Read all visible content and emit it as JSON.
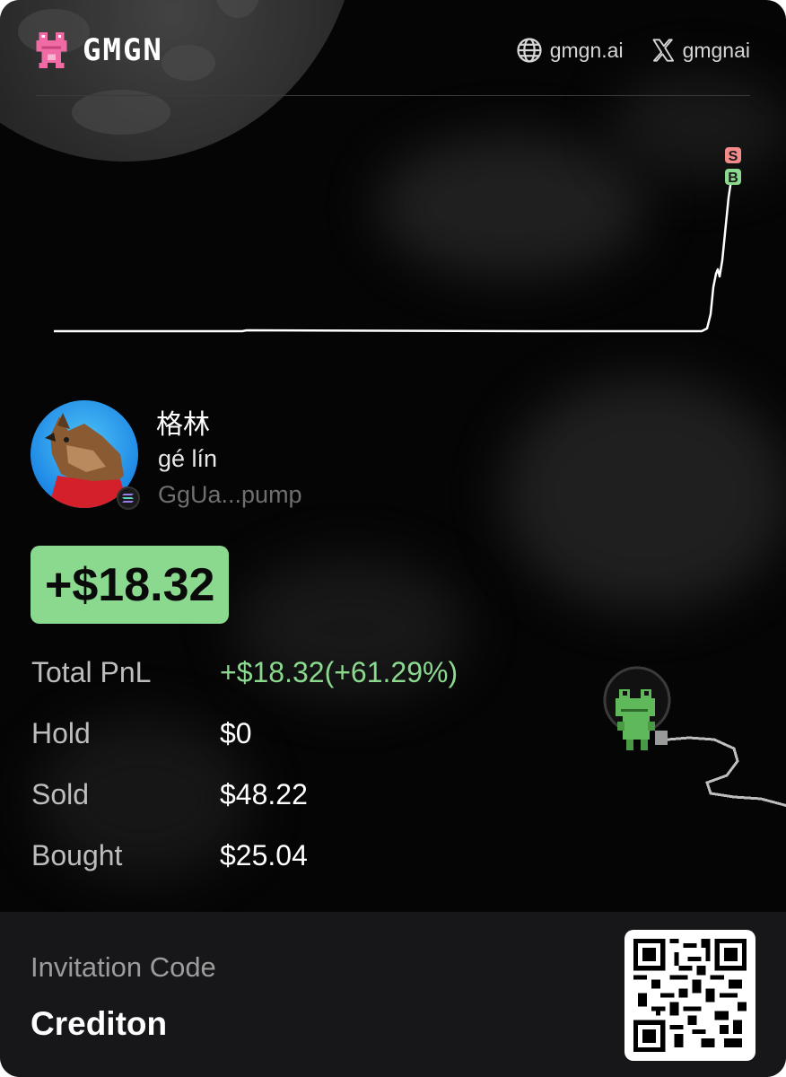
{
  "brand": {
    "name": "GMGN",
    "logo_icon": "pink-frog-logo-icon"
  },
  "header_links": [
    {
      "icon": "globe-icon",
      "label": "gmgn.ai"
    },
    {
      "icon": "x-logo-icon",
      "label": "gmgnai"
    }
  ],
  "chart": {
    "markers": [
      {
        "label": "S",
        "color": "#f48a8a"
      },
      {
        "label": "B",
        "color": "#8ad98f"
      }
    ]
  },
  "token": {
    "name": "格林",
    "subtitle": "gé lín",
    "address": "GgUa...pump",
    "chain_icon": "solana-icon"
  },
  "pnl_badge": "+$18.32",
  "stats": [
    {
      "label": "Total PnL",
      "value": "+$18.32(+61.29%)",
      "color": "#8ad98f"
    },
    {
      "label": "Hold",
      "value": "$0"
    },
    {
      "label": "Sold",
      "value": "$48.22"
    },
    {
      "label": "Bought",
      "value": "$25.04"
    }
  ],
  "footer": {
    "invite_label": "Invitation Code",
    "invite_code": "Crediton"
  },
  "colors": {
    "profit_green": "#8ad98f",
    "sell_red": "#f48a8a",
    "background": "#050505"
  }
}
